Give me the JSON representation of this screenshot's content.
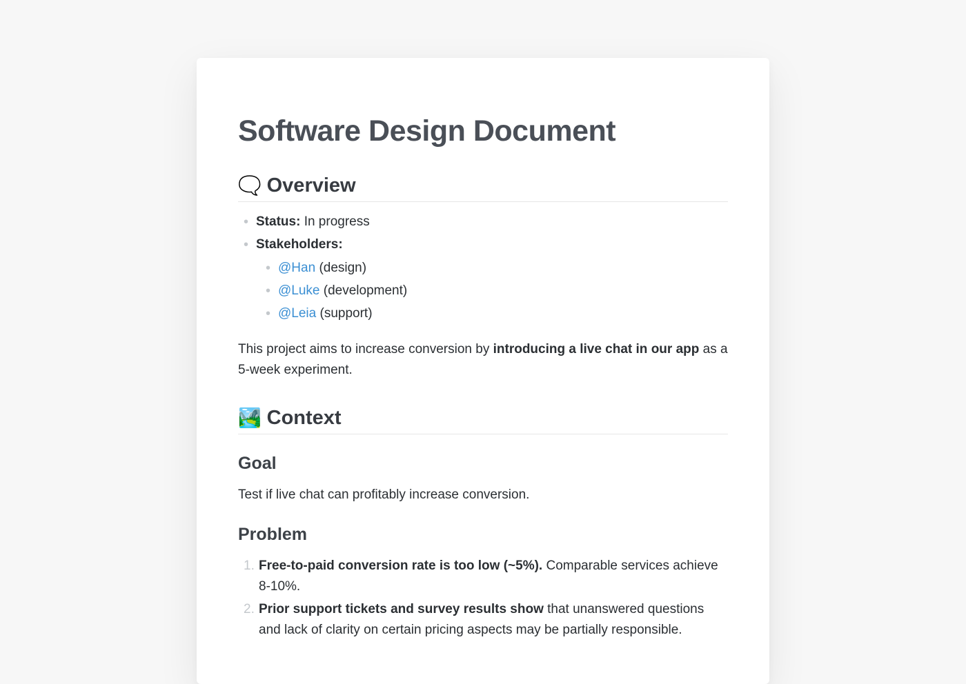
{
  "title": "Software Design Document",
  "overview": {
    "emoji": "🗨️",
    "heading": "Overview",
    "status_label": "Status:",
    "status_value": "In progress",
    "stakeholders_label": "Stakeholders:",
    "stakeholders": [
      {
        "mention": "@Han",
        "role": "(design)"
      },
      {
        "mention": "@Luke",
        "role": "(development)"
      },
      {
        "mention": "@Leia",
        "role": "(support)"
      }
    ],
    "summary_pre": "This project aims to increase conversion by ",
    "summary_bold": "introducing a live chat in our app",
    "summary_post": " as a 5-week experiment."
  },
  "context": {
    "emoji": "🏞️",
    "heading": "Context",
    "goal_heading": "Goal",
    "goal_text": "Test if live chat can profitably increase conversion.",
    "problem_heading": "Problem",
    "problems": [
      {
        "bold": "Free-to-paid conversion rate is too low (~5%).",
        "rest": " Comparable services achieve 8-10%."
      },
      {
        "bold": "Prior support tickets and survey results show",
        "rest": " that unanswered questions and lack of clarity on certain pricing aspects may be partially responsible."
      }
    ]
  }
}
